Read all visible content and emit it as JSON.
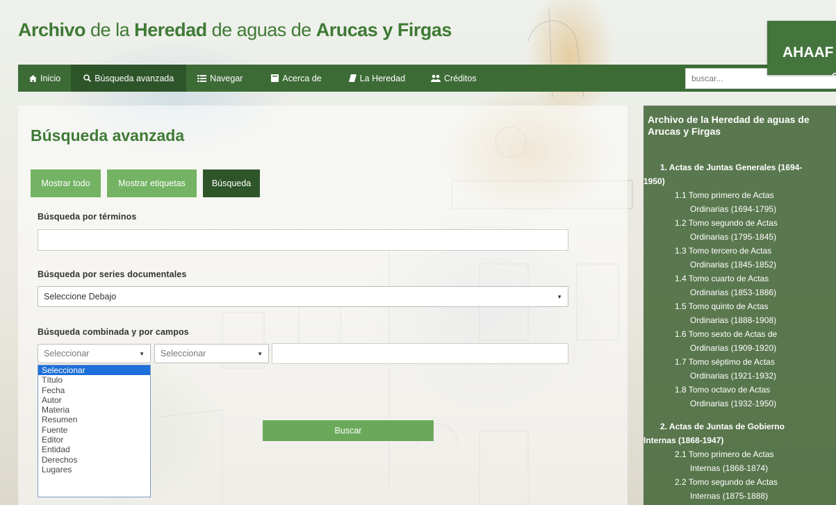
{
  "header": {
    "title_parts": [
      "Archivo",
      " de la ",
      "Heredad",
      " de aguas de ",
      "Arucas y Firgas"
    ],
    "brand": "AHAAF"
  },
  "nav": {
    "items": [
      {
        "label": "Inicio",
        "icon": "home-icon"
      },
      {
        "label": "Búsqueda avanzada",
        "icon": "search-icon"
      },
      {
        "label": "Navegar",
        "icon": "list-icon"
      },
      {
        "label": "Acerca de",
        "icon": "book-icon"
      },
      {
        "label": "La Heredad",
        "icon": "bookmark-icon"
      },
      {
        "label": "Créditos",
        "icon": "users-icon"
      }
    ],
    "active": "Búsqueda avanzada",
    "search_placeholder": "buscar..."
  },
  "main": {
    "title": "Búsqueda avanzada",
    "buttons": [
      "Mostrar todo",
      "Mostrar etiquetas",
      "Búsqueda"
    ],
    "terms_label": "Búsqueda por términos",
    "series_label": "Búsqueda por series documentales",
    "series_select": "Seleccione Debajo",
    "combined_label": "Búsqueda combinada y por campos",
    "field_select": "Seleccionar",
    "operator_select": "Seleccionar",
    "dropdown_options": [
      "Seleccionar",
      "Título",
      "Fecha",
      "Autor",
      "Materia",
      "Resumen",
      "Fuente",
      "Editor",
      "Entidad",
      "Derechos",
      "Lugares"
    ],
    "dropdown_selected": "Seleccionar",
    "search_button": "Buscar"
  },
  "sidebar": {
    "title": "Archivo de la Heredad de aguas de Arucas y Firgas",
    "sec1": [
      "1. Actas de Juntas Generales (1694-",
      "1950)"
    ],
    "items1": [
      [
        "1.1 Tomo primero de Actas",
        "Ordinarias (1694-1795)"
      ],
      [
        "1.2 Tomo segundo de Actas",
        "Ordinarias (1795-1845)"
      ],
      [
        "1.3 Tomo tercero de Actas",
        "Ordinarias (1845-1852)"
      ],
      [
        "1.4 Tomo cuarto de Actas",
        "Ordinarias (1853-1886)"
      ],
      [
        "1.5 Tomo quinto de Actas",
        "Ordinarias (1888-1908)"
      ],
      [
        "1.6 Tomo sexto de Actas de",
        "Ordinarias (1909-1920)"
      ],
      [
        "1.7 Tomo séptimo de Actas",
        "Ordinarias (1921-1932)"
      ],
      [
        "1.8 Tomo octavo de Actas",
        "Ordinarias (1932-1950)"
      ]
    ],
    "sec2": [
      "2. Actas de Juntas de Gobierno",
      "Internas (1868-1947)"
    ],
    "items2": [
      [
        "2.1 Tomo primero de Actas",
        "Internas (1868-1874)"
      ],
      [
        "2.2 Tomo segundo de Actas",
        "Internas (1875-1888)"
      ]
    ]
  }
}
